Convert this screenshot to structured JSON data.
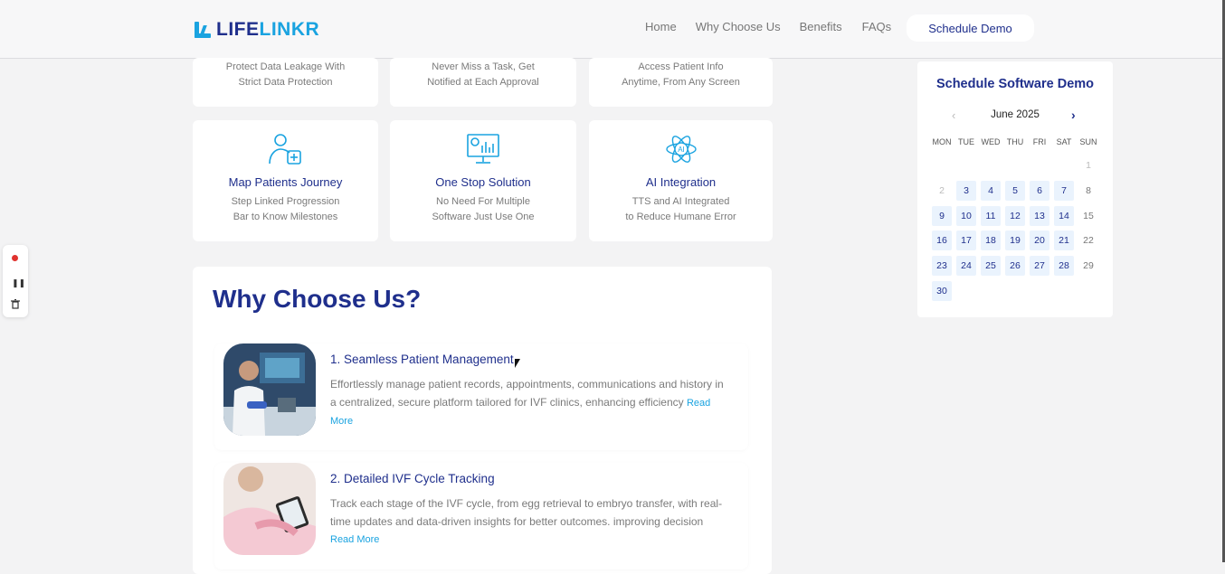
{
  "brand": {
    "part1": "LIFE",
    "part2": "LINKR",
    "primary_color": "#1f2f8c",
    "accent_color": "#1aa3e0"
  },
  "nav": {
    "home": "Home",
    "why": "Why Choose Us",
    "benefits": "Benefits",
    "faqs": "FAQs",
    "cta": "Schedule Demo"
  },
  "top_cards": [
    {
      "line1": "Protect Data Leakage With",
      "line2": "Strict Data Protection"
    },
    {
      "line1": "Never Miss a Task, Get",
      "line2": "Notified at Each Approval"
    },
    {
      "line1": "Access Patient Info",
      "line2": "Anytime, From Any Screen"
    }
  ],
  "features": [
    {
      "icon": "user-plus-icon",
      "title": "Map Patients Journey",
      "line1": "Step Linked Progression",
      "line2": "Bar to Know Milestones"
    },
    {
      "icon": "monitor-chart-icon",
      "title": "One Stop Solution",
      "line1": "No Need For Multiple",
      "line2": "Software Just Use One"
    },
    {
      "icon": "ai-atom-icon",
      "title": "AI Integration",
      "line1": "TTS and AI Integrated",
      "line2": "to Reduce Humane Error"
    }
  ],
  "why": {
    "heading": "Why Choose Us?",
    "items": [
      {
        "title": "1. Seamless Patient Management",
        "text": "Effortlessly manage patient records, appointments, communications and history in a centralized, secure platform tailored for IVF clinics, enhancing efficiency",
        "read_more": "Read More"
      },
      {
        "title": "2. Detailed IVF Cycle Tracking",
        "text": "Track each stage of the IVF cycle, from egg retrieval to embryo transfer, with real-time updates and data-driven insights for better outcomes. improving decision",
        "read_more": "Read More"
      }
    ]
  },
  "calendar": {
    "title": "Schedule Software Demo",
    "month": "June 2025",
    "weekdays": [
      "MON",
      "TUE",
      "WED",
      "THU",
      "FRI",
      "SAT",
      "SUN"
    ],
    "days": [
      [
        "",
        "",
        "",
        "",
        "",
        "",
        "1"
      ],
      [
        "2",
        "3",
        "4",
        "5",
        "6",
        "7",
        "8"
      ],
      [
        "9",
        "10",
        "11",
        "12",
        "13",
        "14",
        "15"
      ],
      [
        "16",
        "17",
        "18",
        "19",
        "20",
        "21",
        "22"
      ],
      [
        "23",
        "24",
        "25",
        "26",
        "27",
        "28",
        "29"
      ],
      [
        "30",
        "",
        "",
        "",
        "",
        "",
        ""
      ]
    ],
    "available": [
      "3",
      "4",
      "5",
      "6",
      "7",
      "9",
      "10",
      "11",
      "12",
      "13",
      "14",
      "16",
      "17",
      "18",
      "19",
      "20",
      "21",
      "23",
      "24",
      "25",
      "26",
      "27",
      "28",
      "30"
    ],
    "muted": [
      "1",
      "2"
    ]
  }
}
